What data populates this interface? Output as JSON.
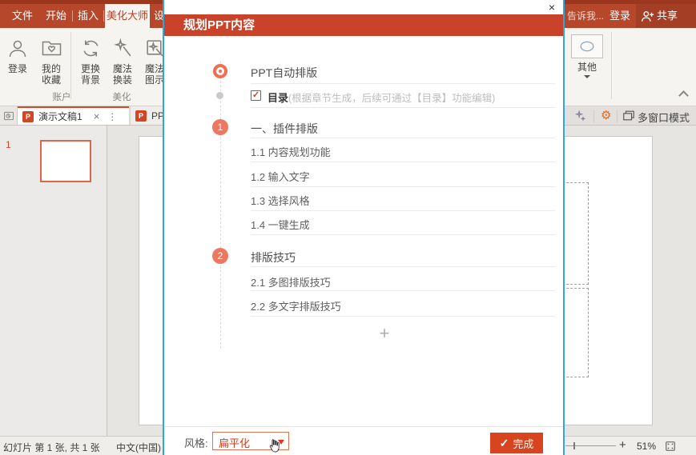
{
  "ribbon": {
    "tabs": [
      "文件",
      "开始",
      "插入",
      "美化大师",
      "设计"
    ],
    "tell_me": "告诉我...",
    "sign_in": "登录",
    "share": "共享",
    "collapse_hint": "collapse-ribbon",
    "groups": {
      "account": {
        "label": "账户",
        "buttons": [
          {
            "line1": "登录",
            "line2": ""
          },
          {
            "line1": "我的",
            "line2": "收藏"
          }
        ]
      },
      "beautify": {
        "label": "美化",
        "buttons": [
          {
            "line1": "更换",
            "line2": "背景"
          },
          {
            "line1": "魔法",
            "line2": "换装"
          },
          {
            "line1": "魔法",
            "line2": "图示"
          }
        ]
      },
      "other": {
        "label": "其他"
      }
    }
  },
  "doc_tabs": {
    "tab1": "演示文稿1",
    "tab1_close": "×",
    "tab1_menu": "⋮",
    "tab2": "PP",
    "multi_window": "多窗口模式"
  },
  "slides_panel": {
    "slide_number": "1"
  },
  "dialog": {
    "close": "×",
    "title": "规划PPT内容",
    "auto_layout": "PPT自动排版",
    "toc_check": "✓",
    "toc_label": "目录",
    "toc_hint": "(根据章节生成，后续可通过【目录】功能编辑)",
    "sections": [
      {
        "num": "1",
        "title": "一、插件排版",
        "items": [
          "1.1 内容规划功能",
          "1.2 输入文字",
          "1.3 选择风格",
          "1.4 一键生成"
        ]
      },
      {
        "num": "2",
        "title": "排版技巧",
        "items": [
          "2.1 多图排版技巧",
          "2.2 多文字排版技巧"
        ]
      }
    ],
    "add": "+",
    "style_label": "风格:",
    "style_value": "扁平化",
    "done_check": "✓",
    "done": "完成"
  },
  "status_bar": {
    "slide_info": "幻灯片 第 1 张, 共 1 张",
    "language": "中文(中国)",
    "zoom_plus": "+",
    "zoom_level": "51%"
  },
  "colors": {
    "ribbon_red": "#B7472A",
    "dialog_header": "#C8432A",
    "accent_circle": "#EE7761",
    "done_button": "#D8441F",
    "dialog_border": "#2BA7DD",
    "thumb_border": "#E0654A"
  }
}
